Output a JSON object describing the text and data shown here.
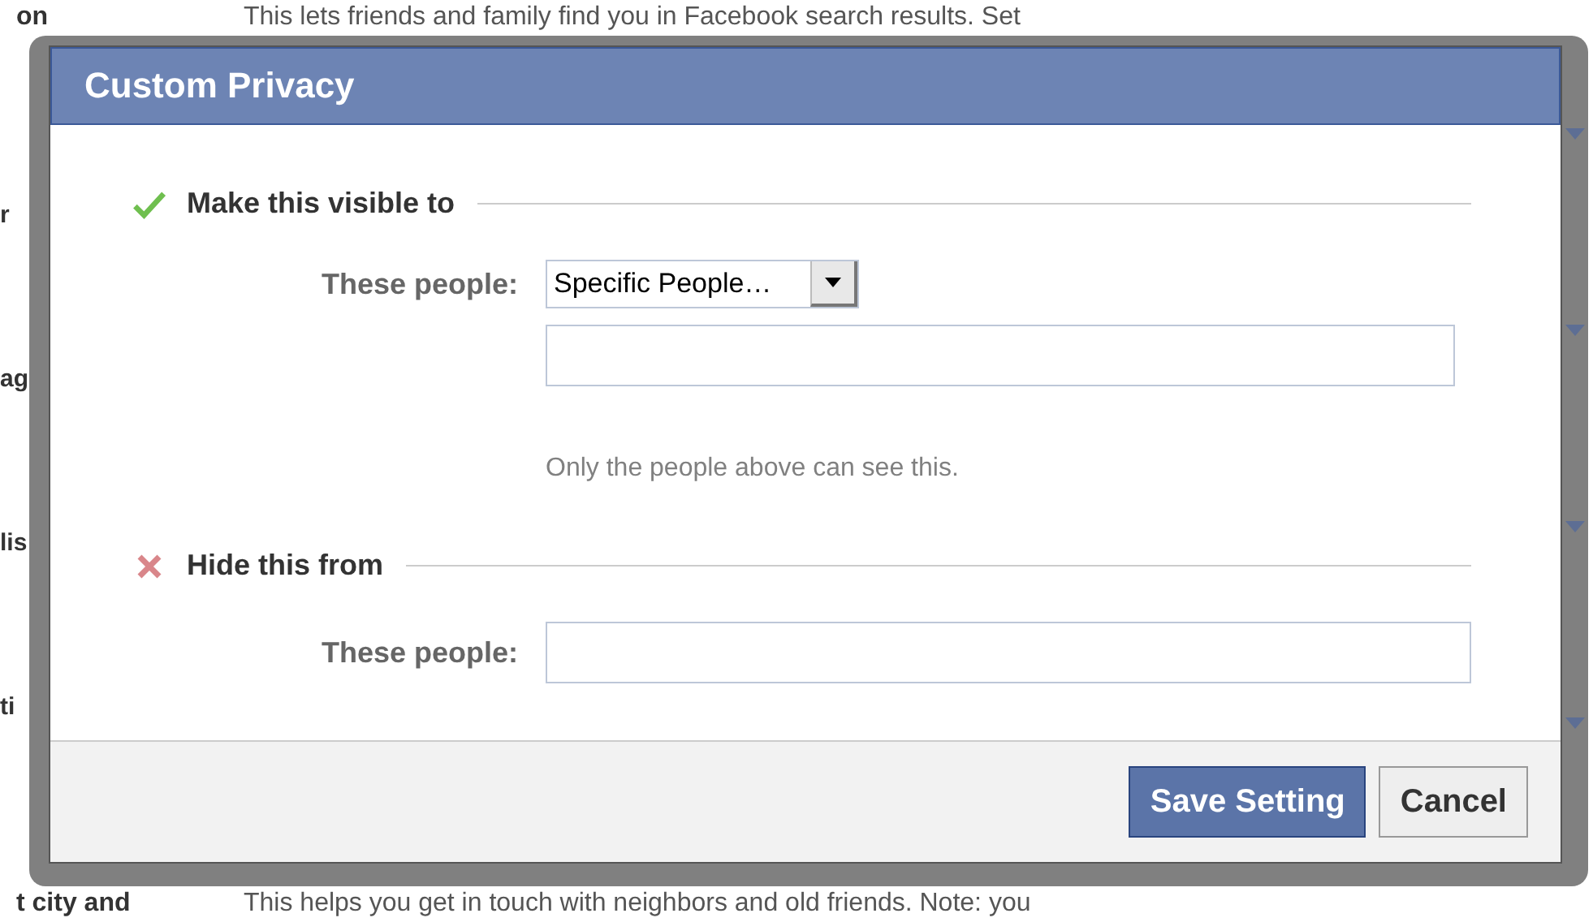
{
  "background": {
    "top_row": {
      "label": "on",
      "description": "This lets friends and family find you in Facebook search results. Set"
    },
    "side_fragments": [
      "r",
      "ag",
      "lis",
      "ti"
    ],
    "bottom_row": {
      "label": "t city and",
      "description": "This helps you get in touch with neighbors and old friends. Note: you"
    }
  },
  "dialog": {
    "title": "Custom Privacy",
    "sections": [
      {
        "kind": "allow",
        "heading": "Make this visible to",
        "fields": [
          {
            "kind": "select",
            "label": "These people:",
            "value": "Specific People…"
          },
          {
            "kind": "input"
          }
        ],
        "note": "Only the people above can see this."
      },
      {
        "kind": "deny",
        "heading": "Hide this from",
        "fields": [
          {
            "kind": "input",
            "label": "These people:"
          }
        ]
      }
    ],
    "buttons": [
      {
        "label": "Save Setting",
        "kind": "primary"
      },
      {
        "label": "Cancel",
        "kind": "secondary"
      }
    ]
  }
}
